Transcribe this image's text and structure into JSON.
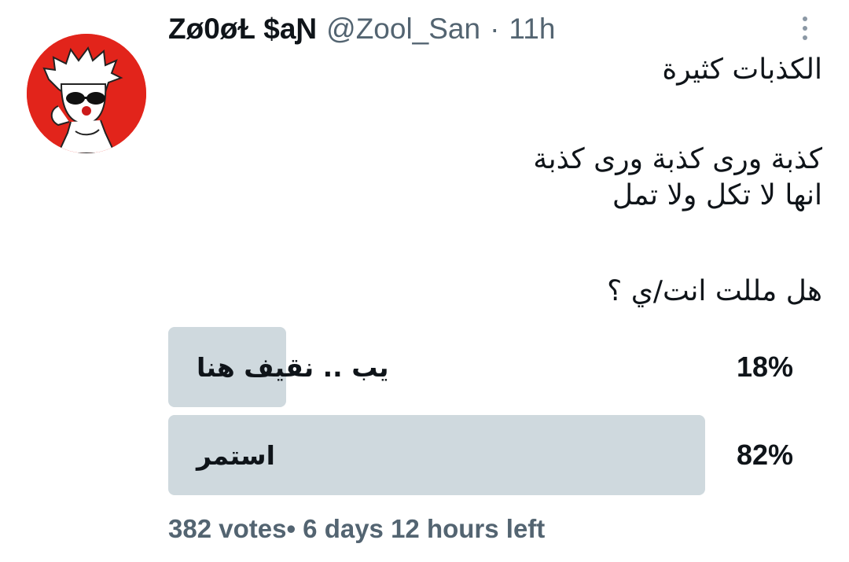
{
  "author": {
    "display_name": "Zø0øⱢ $aƝ",
    "handle": "@Zool_San",
    "separator": "·",
    "time": "11h"
  },
  "tweet": {
    "lines": [
      "الكذبات كثيرة",
      "كذبة ورى كذبة ورى كذبة",
      "انها لا تكل ولا تمل",
      "هل مللت انت/ي  ؟"
    ]
  },
  "poll": {
    "options": [
      {
        "label": "يب .. نقيف هنا",
        "percent_label": "18%",
        "percent": 18
      },
      {
        "label": "استمر",
        "percent_label": "82%",
        "percent": 82
      }
    ],
    "votes": "382 votes",
    "bullet": "•",
    "time_left": "6 days 12 hours left"
  },
  "colors": {
    "poll_bar": "#cfd9de",
    "secondary_text": "#536471",
    "avatar_bg": "#e2241b"
  },
  "icons": {
    "more": "more-vertical-icon"
  }
}
